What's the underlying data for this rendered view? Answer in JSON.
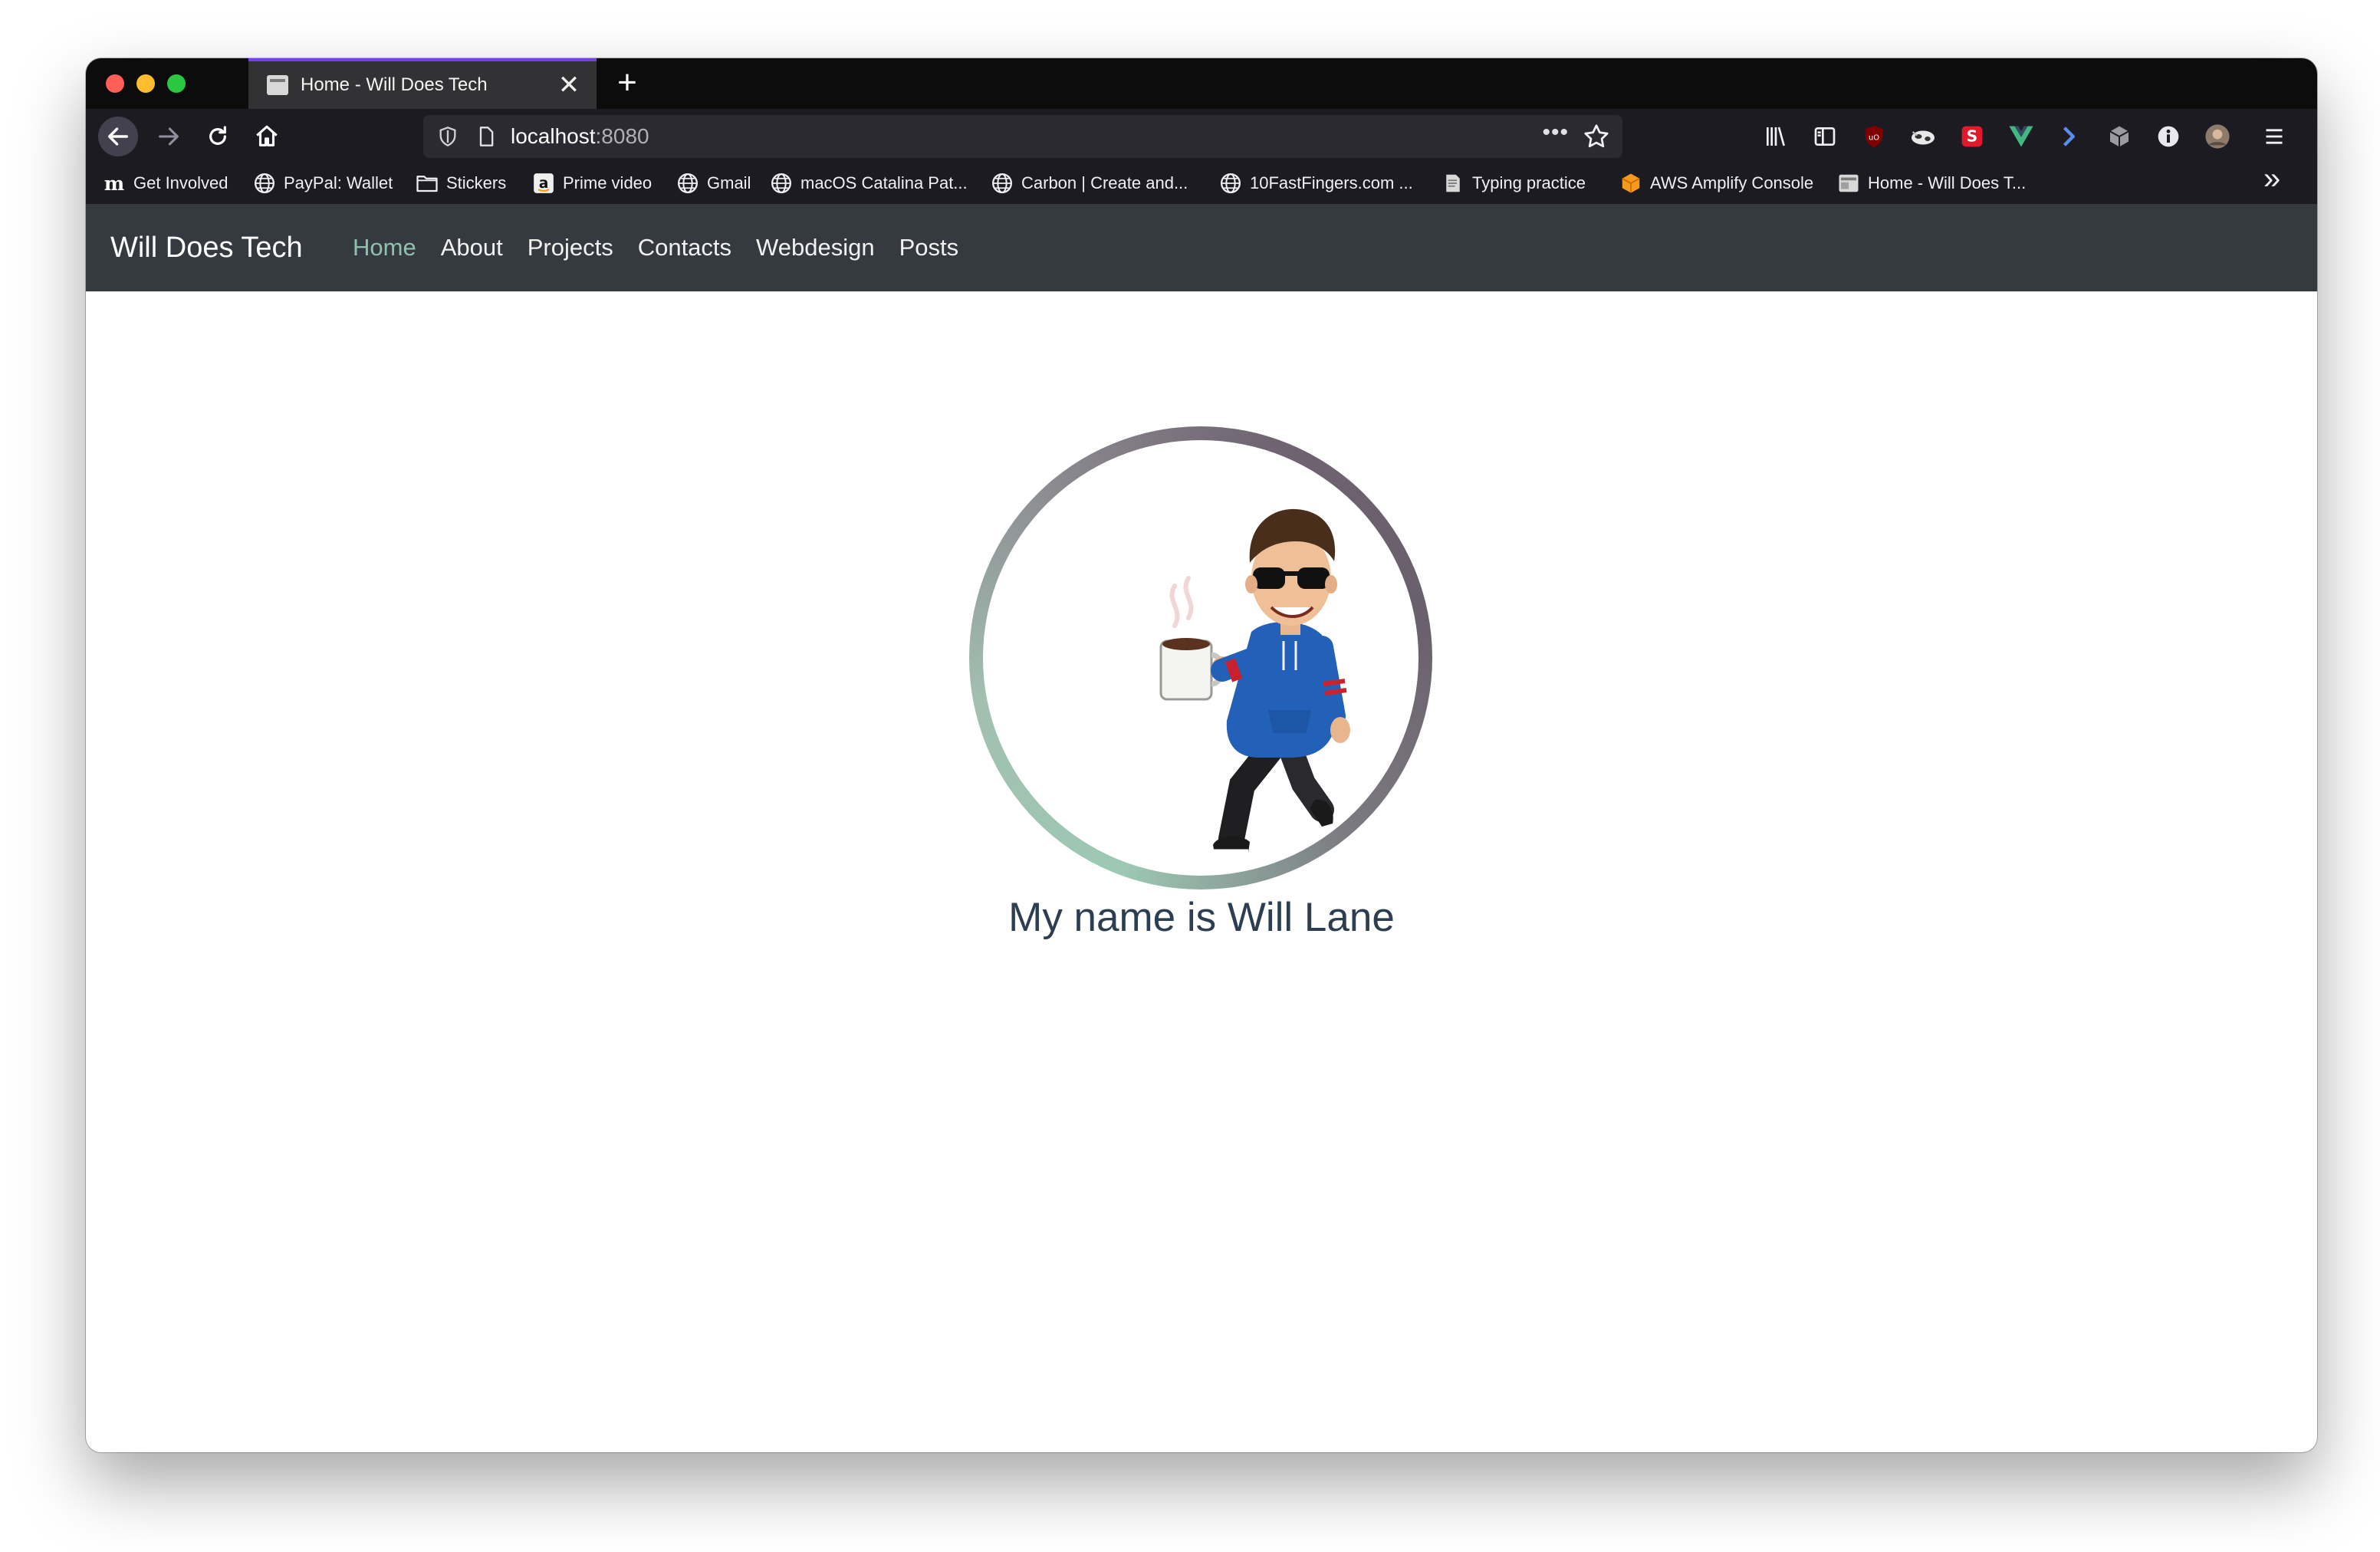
{
  "browser": {
    "tab": {
      "title": "Home - Will Does Tech",
      "close_glyph": "✕"
    },
    "new_tab_glyph": "+",
    "url": {
      "host": "localhost",
      "port": ":8080",
      "menu_glyph": "•••"
    },
    "extensions": [
      "library-icon",
      "sidebar-icon",
      "ublock-icon",
      "cow-extension-icon",
      "s-extension-icon",
      "vue-devtools-icon",
      "arrow-extension-icon",
      "cube-extension-icon",
      "info-extension-icon",
      "profile-avatar-icon",
      "hamburger-menu-icon"
    ],
    "bookmarks": [
      {
        "label": "Get Involved",
        "icon": "m-icon"
      },
      {
        "label": "PayPal: Wallet",
        "icon": "globe-icon"
      },
      {
        "label": "Stickers",
        "icon": "folder-icon"
      },
      {
        "label": "Prime video",
        "icon": "amazon-icon"
      },
      {
        "label": "Gmail",
        "icon": "globe-icon"
      },
      {
        "label": "macOS Catalina Pat...",
        "icon": "globe-icon"
      },
      {
        "label": "Carbon | Create and...",
        "icon": "globe-icon"
      },
      {
        "label": "10FastFingers.com ...",
        "icon": "globe-icon"
      },
      {
        "label": "Typing practice",
        "icon": "paper-icon"
      },
      {
        "label": "AWS Amplify Console",
        "icon": "aws-cube-icon"
      },
      {
        "label": "Home - Will Does T...",
        "icon": "page-icon"
      }
    ],
    "overflow_glyph": "»"
  },
  "site": {
    "brand": "Will Does Tech",
    "nav": [
      "Home",
      "About",
      "Projects",
      "Contacts",
      "Webdesign",
      "Posts"
    ],
    "active_nav": "Home",
    "greeting": "My name is Will Lane"
  },
  "colors": {
    "nav_bg": "#343a40",
    "active_link": "#8fc1ad",
    "heading": "#2c3e50",
    "ring_start": "#9dc8b4",
    "ring_end": "#6a5f6d"
  }
}
